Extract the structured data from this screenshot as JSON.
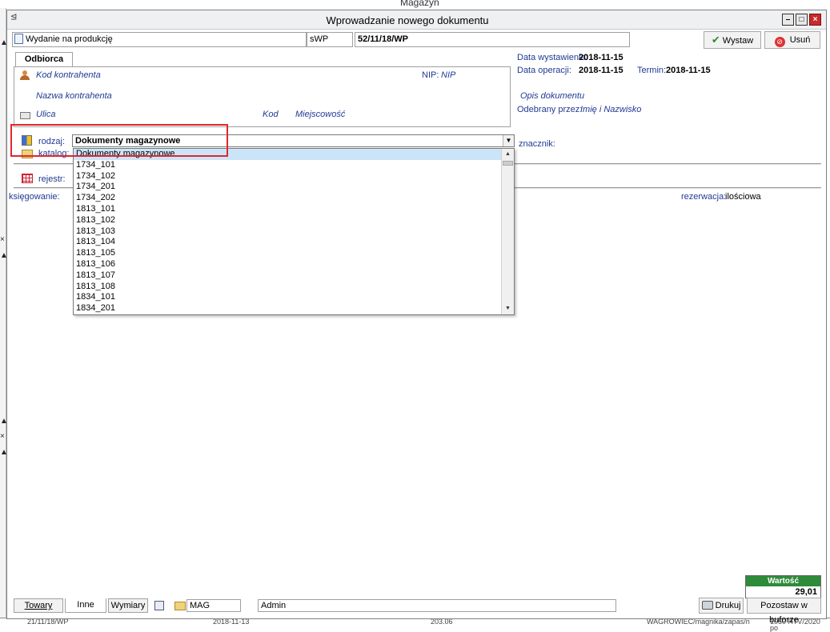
{
  "background_app": {
    "title": "Magazyn",
    "bottom_row": [
      "21/11/18/WP",
      "2018-11-13",
      "203.06",
      "WAGROWIEC/magnika/zapas/n",
      "1050 RTV/2020 po"
    ]
  },
  "window": {
    "title": "Wprowadzanie nowego dokumentu",
    "minimize": "–",
    "maximize": "□",
    "close": "×"
  },
  "toolbar": {
    "document_type": "Wydanie na produkcję",
    "series": "sWP",
    "number": "52/11/18/WP",
    "issue_button": "Wystaw",
    "delete_button": "Usuń"
  },
  "recipient": {
    "tab": "Odbiorca",
    "contractor_code": "Kod kontrahenta",
    "nip_label": "NIP:",
    "nip_value": "NIP",
    "contractor_name": "Nazwa kontrahenta",
    "street": "Ulica",
    "postal_code": "Kod",
    "city": "Miejscowość"
  },
  "dates": {
    "issue_label": "Data wystawienia:",
    "issue_value": "2018-11-15",
    "operation_label": "Data operacji:",
    "operation_value": "2018-11-15",
    "due_label": "Termin:",
    "due_value": "2018-11-15",
    "description_placeholder": "Opis dokumentu",
    "received_by_label": "Odebrany przez:",
    "received_by_value": "Imię i Nazwisko"
  },
  "form": {
    "kind_label": "rodzaj:",
    "kind_value": "Dokumenty magazynowe",
    "catalog_label": "katalog:",
    "marker_label": "znacznik:",
    "register_label": "rejestr:",
    "posting_label": "księgowanie:",
    "reservation_label": "rezerwacja:",
    "reservation_value": "ilościowa"
  },
  "dropdown": {
    "items": [
      "Dokumenty magazynowe",
      "1734_101",
      "1734_102",
      "1734_201",
      "1734_202",
      "1813_101",
      "1813_102",
      "1813_103",
      "1813_104",
      "1813_105",
      "1813_106",
      "1813_107",
      "1813_108",
      "1834_101",
      "1834_201"
    ],
    "selected_index": 0
  },
  "summary": {
    "value_label": "Wartość",
    "value": "29,01"
  },
  "bottom_bar": {
    "tabs": [
      "Towary",
      "Inne",
      "Wymiary"
    ],
    "active_tab": 1,
    "warehouse": "MAG",
    "user": "Admin",
    "print_button": "Drukuj",
    "buffer_button": "Pozostaw w buforze"
  },
  "colors": {
    "highlight": "#e0262e",
    "value_header": "#2e8b3a",
    "label_blue": "#1f3a93",
    "selection": "#cce4f7"
  }
}
